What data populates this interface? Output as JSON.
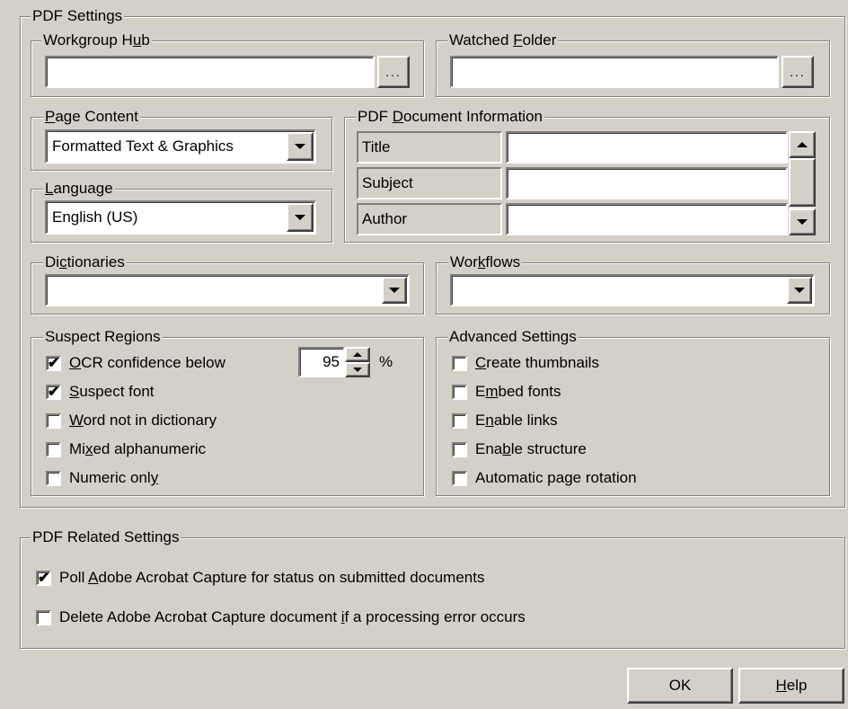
{
  "pdf_settings": {
    "legend": "PDF Settings",
    "workgroup_hub": {
      "legend_pre": "Workgroup H",
      "legend_ul": "u",
      "legend_post": "b",
      "value": "",
      "browse_label": "..."
    },
    "watched_folder": {
      "legend_pre": "Watched ",
      "legend_ul": "F",
      "legend_post": "older",
      "value": "",
      "browse_label": "..."
    },
    "page_content": {
      "legend_pre": "",
      "legend_ul": "P",
      "legend_post": "age Content",
      "selected": "Formatted Text & Graphics"
    },
    "language": {
      "legend_pre": "",
      "legend_ul": "L",
      "legend_post": "anguage",
      "selected": "English (US)"
    },
    "doc_info": {
      "legend_pre": "PDF ",
      "legend_ul": "D",
      "legend_post": "ocument Information",
      "rows": [
        {
          "label": "Title",
          "value": ""
        },
        {
          "label": "Subject",
          "value": ""
        },
        {
          "label": "Author",
          "value": ""
        }
      ]
    },
    "dictionaries": {
      "legend_pre": "Di",
      "legend_ul": "c",
      "legend_post": "tionaries",
      "selected": ""
    },
    "workflows": {
      "legend_pre": "Wor",
      "legend_ul": "k",
      "legend_post": "flows",
      "selected": ""
    },
    "suspect_regions": {
      "legend": "Suspect Regions",
      "ocr": {
        "pre": "",
        "ul": "O",
        "post": "CR confidence below",
        "checked": true,
        "value": "95",
        "unit": "%"
      },
      "items": [
        {
          "pre": "",
          "ul": "S",
          "post": "uspect font",
          "checked": true
        },
        {
          "pre": "",
          "ul": "W",
          "post": "ord not in dictionary",
          "checked": false
        },
        {
          "pre": "Mi",
          "ul": "x",
          "post": "ed alphanumeric",
          "checked": false
        },
        {
          "pre": "Numeric onl",
          "ul": "y",
          "post": "",
          "checked": false
        }
      ]
    },
    "advanced": {
      "legend": "Advanced Settings",
      "items": [
        {
          "pre": "",
          "ul": "C",
          "post": "reate thumbnails",
          "checked": false
        },
        {
          "pre": "E",
          "ul": "m",
          "post": "bed fonts",
          "checked": false
        },
        {
          "pre": "E",
          "ul": "n",
          "post": "able links",
          "checked": false
        },
        {
          "pre": "Ena",
          "ul": "b",
          "post": "le structure",
          "checked": false
        },
        {
          "pre": "Automatic page rotation",
          "ul": "",
          "post": "",
          "checked": false
        }
      ]
    }
  },
  "related": {
    "legend": "PDF Related Settings",
    "items": [
      {
        "pre": "Poll ",
        "ul": "A",
        "post": "dobe Acrobat Capture for status on submitted documents",
        "checked": true
      },
      {
        "pre": "Delete Adobe Acrobat Capture document ",
        "ul": "i",
        "post": "f a processing error occurs",
        "checked": false
      }
    ]
  },
  "buttons": {
    "ok": {
      "label": "OK"
    },
    "help": {
      "pre": "",
      "ul": "H",
      "post": "elp"
    }
  },
  "check_glyph": "✔"
}
